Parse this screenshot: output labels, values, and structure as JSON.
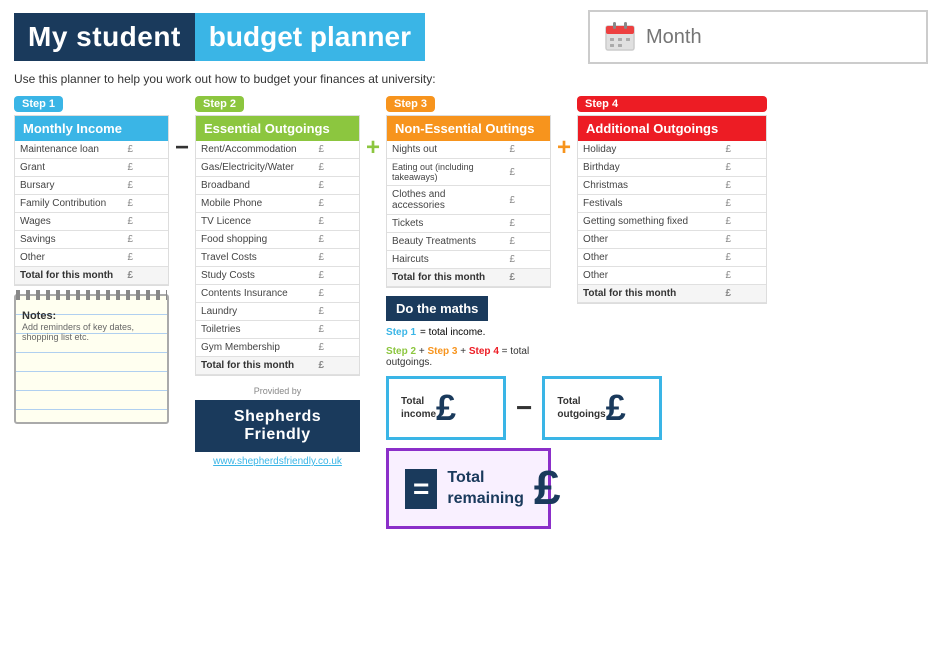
{
  "header": {
    "title_part1": "My student",
    "title_part2": "budget planner",
    "month_placeholder": "Month"
  },
  "subtitle": "Use this planner to help you work out how to budget your finances at university:",
  "steps": {
    "step1": {
      "label": "Step 1",
      "section_title": "Monthly Income",
      "rows": [
        {
          "label": "Maintenance loan",
          "pound": "£"
        },
        {
          "label": "Grant",
          "pound": "£"
        },
        {
          "label": "Bursary",
          "pound": "£"
        },
        {
          "label": "Family Contribution",
          "pound": "£"
        },
        {
          "label": "Wages",
          "pound": "£"
        },
        {
          "label": "Savings",
          "pound": "£"
        },
        {
          "label": "Other",
          "pound": "£"
        },
        {
          "label": "Total for this month",
          "pound": "£"
        }
      ]
    },
    "step2": {
      "label": "Step 2",
      "section_title": "Essential Outgoings",
      "rows": [
        {
          "label": "Rent/Accommodation",
          "pound": "£"
        },
        {
          "label": "Gas/Electricity/Water",
          "pound": "£"
        },
        {
          "label": "Broadband",
          "pound": "£"
        },
        {
          "label": "Mobile Phone",
          "pound": "£"
        },
        {
          "label": "TV Licence",
          "pound": "£"
        },
        {
          "label": "Food shopping",
          "pound": "£"
        },
        {
          "label": "Travel Costs",
          "pound": "£"
        },
        {
          "label": "Study Costs",
          "pound": "£"
        },
        {
          "label": "Contents Insurance",
          "pound": "£"
        },
        {
          "label": "Laundry",
          "pound": "£"
        },
        {
          "label": "Toiletries",
          "pound": "£"
        },
        {
          "label": "Gym Membership",
          "pound": "£"
        },
        {
          "label": "Total for this month",
          "pound": "£"
        }
      ]
    },
    "step3": {
      "label": "Step 3",
      "section_title": "Non-Essential Outings",
      "rows": [
        {
          "label": "Nights out",
          "pound": "£"
        },
        {
          "label": "Eating out (including takeaways)",
          "pound": "£"
        },
        {
          "label": "Clothes and accessories",
          "pound": "£"
        },
        {
          "label": "Tickets",
          "pound": "£"
        },
        {
          "label": "Beauty Treatments",
          "pound": "£"
        },
        {
          "label": "Haircuts",
          "pound": "£"
        },
        {
          "label": "Total for this month",
          "pound": "£"
        }
      ]
    },
    "step4": {
      "label": "Step 4",
      "section_title": "Additional Outgoings",
      "rows": [
        {
          "label": "Holiday",
          "pound": "£"
        },
        {
          "label": "Birthday",
          "pound": "£"
        },
        {
          "label": "Christmas",
          "pound": "£"
        },
        {
          "label": "Festivals",
          "pound": "£"
        },
        {
          "label": "Getting something fixed",
          "pound": "£"
        },
        {
          "label": "Other",
          "pound": "£"
        },
        {
          "label": "Other",
          "pound": "£"
        },
        {
          "label": "Other",
          "pound": "£"
        },
        {
          "label": "Total for this month",
          "pound": "£"
        }
      ]
    }
  },
  "notes": {
    "header": "Notes:",
    "subtitle": "Add reminders of key dates, shopping list etc."
  },
  "provided_by": "Provided by",
  "shepherds": {
    "name": "Shepherds Friendly",
    "url": "www.shepherdsfriendly.co.uk"
  },
  "do_maths": {
    "header": "Do the maths",
    "step1_label": "Step 1",
    "step1_suffix": "= total income.",
    "steps_suffix": "Step 2 + Step 3 + Step 4 = total outgoings.",
    "total_income_label": "Total\nincome",
    "total_outgoings_label": "Total\noutgoings",
    "total_remaining_label": "Total\nremaining"
  }
}
